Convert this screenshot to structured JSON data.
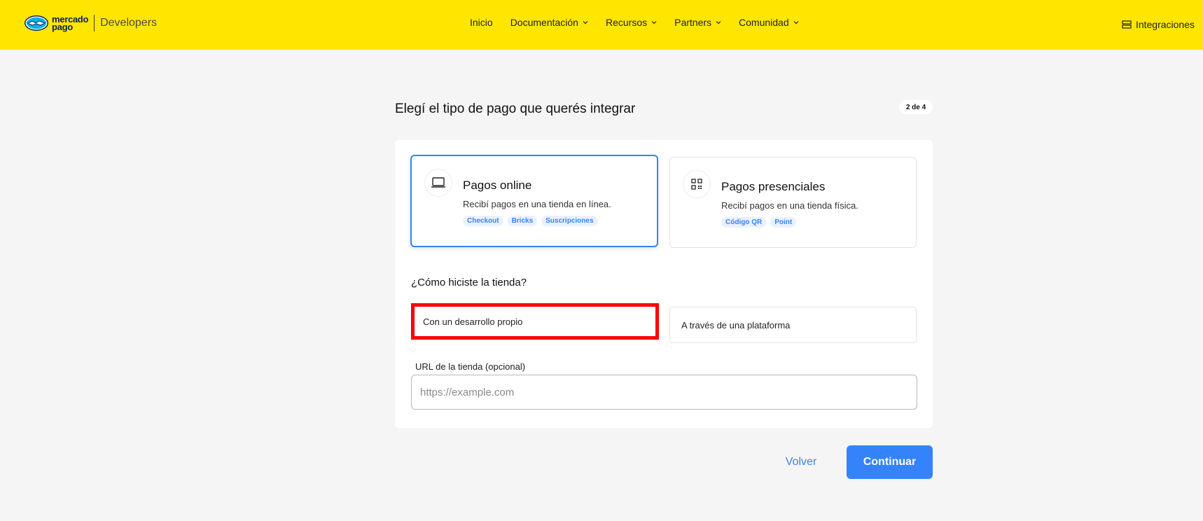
{
  "header": {
    "logo_line1": "mercado",
    "logo_line2": "pago",
    "logo_section": "Developers",
    "nav": [
      {
        "label": "Inicio",
        "has_dropdown": false
      },
      {
        "label": "Documentación",
        "has_dropdown": true
      },
      {
        "label": "Recursos",
        "has_dropdown": true
      },
      {
        "label": "Partners",
        "has_dropdown": true
      },
      {
        "label": "Comunidad",
        "has_dropdown": true
      }
    ],
    "integrations_label": "Integraciones",
    "bg_color": "#ffe600"
  },
  "main": {
    "title": "Elegí el tipo de pago que querés integrar",
    "step": "2 de 4",
    "payment_types": [
      {
        "title": "Pagos online",
        "description": "Recibí pagos en una tienda en línea.",
        "tags": [
          "Checkout",
          "Bricks",
          "Suscripciones"
        ],
        "icon": "laptop-icon",
        "selected": true
      },
      {
        "title": "Pagos presenciales",
        "description": "Recibí pagos en una tienda física.",
        "tags": [
          "Código QR",
          "Point"
        ],
        "icon": "qr-code-icon",
        "selected": false
      }
    ],
    "how_title": "¿Cómo hiciste la tienda?",
    "options": [
      {
        "label": "Con un desarrollo propio",
        "highlighted": true
      },
      {
        "label": "A través de una plataforma",
        "highlighted": false
      }
    ],
    "url_label": "URL de la tienda (opcional)",
    "url_value": "",
    "url_placeholder": "https://example.com"
  },
  "footer_actions": {
    "back_label": "Volver",
    "continue_label": "Continuar",
    "accent_color": "#3483fa"
  }
}
